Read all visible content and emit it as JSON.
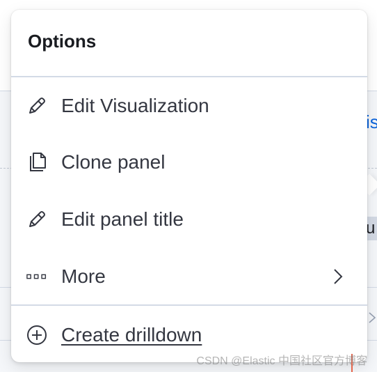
{
  "popover": {
    "title": "Options",
    "items": [
      {
        "label": "Edit Visualization",
        "icon": "pencil-icon"
      },
      {
        "label": "Clone panel",
        "icon": "copy-icon"
      },
      {
        "label": "Edit panel title",
        "icon": "pencil-icon"
      },
      {
        "label": "More",
        "icon": "boxes-horizontal-icon",
        "submenu": true
      }
    ],
    "footer_item": {
      "label": "Create drilldown",
      "icon": "plus-in-circle-icon"
    }
  },
  "background": {
    "link_fragment": "is",
    "chip_fragment": "u"
  },
  "watermark": "CSDN @Elastic 中国社区官方博客",
  "colors": {
    "text": "#343741",
    "title": "#1a1c21",
    "divider": "#d3dae6",
    "link": "#0b64dd"
  }
}
